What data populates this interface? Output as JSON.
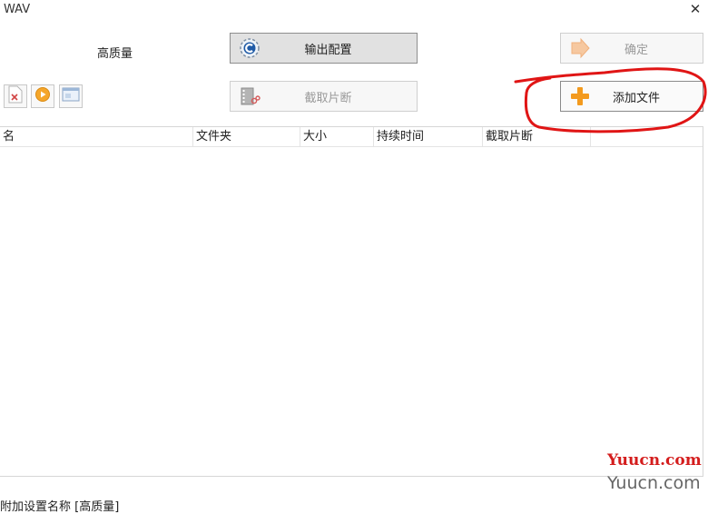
{
  "window": {
    "title": "WAV",
    "close_icon": "close-icon"
  },
  "config": {
    "quality_label": "高质量"
  },
  "buttons": {
    "output_config": "输出配置",
    "confirm": "确定",
    "clip": "截取片断",
    "add_file": "添加文件"
  },
  "toolbar": {
    "icons": [
      "file-remove-icon",
      "play-icon",
      "window-icon"
    ]
  },
  "table": {
    "columns": [
      "名",
      "文件夹",
      "大小",
      "持续时间",
      "截取片断",
      ""
    ]
  },
  "status": {
    "text": "附加设置名称 [高质量]"
  },
  "watermark": {
    "red": "Yuucn.com",
    "gray": "Yuucn.com"
  },
  "colors": {
    "annotation": "#e01515",
    "add_icon": "#f39a1e"
  }
}
